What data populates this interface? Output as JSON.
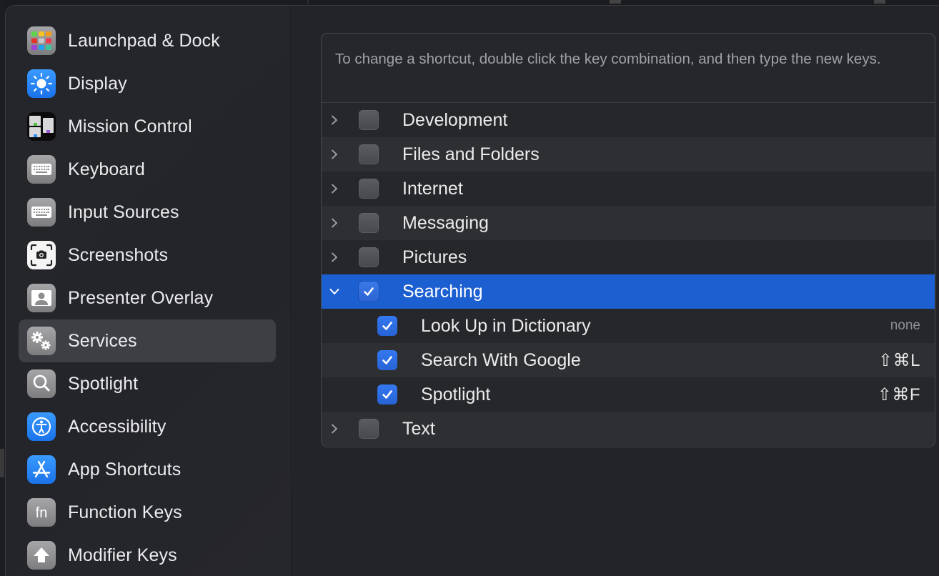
{
  "sidebar": {
    "items": [
      {
        "label": "Launchpad & Dock",
        "icon": "launchpad-icon"
      },
      {
        "label": "Display",
        "icon": "display-brightness-icon"
      },
      {
        "label": "Mission Control",
        "icon": "mission-control-icon"
      },
      {
        "label": "Keyboard",
        "icon": "keyboard-icon"
      },
      {
        "label": "Input Sources",
        "icon": "keyboard-icon"
      },
      {
        "label": "Screenshots",
        "icon": "screenshot-camera-icon"
      },
      {
        "label": "Presenter Overlay",
        "icon": "person-icon"
      },
      {
        "label": "Services",
        "icon": "gears-icon",
        "selected": true
      },
      {
        "label": "Spotlight",
        "icon": "magnifier-icon"
      },
      {
        "label": "Accessibility",
        "icon": "accessibility-icon"
      },
      {
        "label": "App Shortcuts",
        "icon": "app-store-icon"
      },
      {
        "label": "Function Keys",
        "icon": "fn-key-icon"
      },
      {
        "label": "Modifier Keys",
        "icon": "up-arrow-icon"
      }
    ]
  },
  "main": {
    "info_text": "To change a shortcut, double click the key combination, and then type the new keys.",
    "categories": [
      {
        "label": "Development",
        "expanded": false,
        "checked": false
      },
      {
        "label": "Files and Folders",
        "expanded": false,
        "checked": false
      },
      {
        "label": "Internet",
        "expanded": false,
        "checked": false
      },
      {
        "label": "Messaging",
        "expanded": false,
        "checked": false
      },
      {
        "label": "Pictures",
        "expanded": false,
        "checked": false
      },
      {
        "label": "Searching",
        "expanded": true,
        "checked": true,
        "selected": true,
        "children": [
          {
            "label": "Look Up in Dictionary",
            "checked": true,
            "shortcut": "none"
          },
          {
            "label": "Search With Google",
            "checked": true,
            "shortcut": "⇧⌘L"
          },
          {
            "label": "Spotlight",
            "checked": true,
            "shortcut": "⇧⌘F"
          }
        ]
      },
      {
        "label": "Text",
        "expanded": false,
        "checked": false
      }
    ]
  },
  "colors": {
    "selection_blue": "#1c5fd0",
    "checkbox_blue": "#2f6fe6",
    "sidebar_selected": "#3e3f44"
  }
}
